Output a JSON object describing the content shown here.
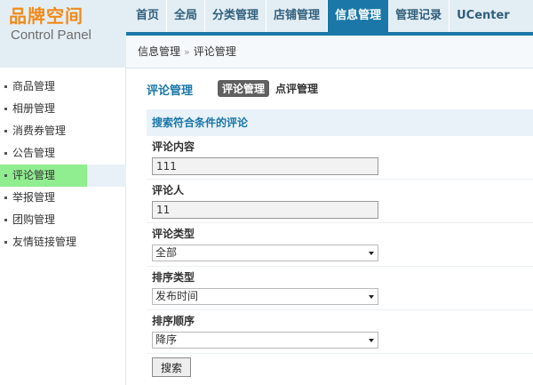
{
  "logo": {
    "title": "品牌空间",
    "subtitle": "Control Panel"
  },
  "nav": {
    "items": [
      "首页",
      "全局",
      "分类管理",
      "店铺管理",
      "信息管理",
      "管理记录",
      "UCenter"
    ],
    "active_index": 4
  },
  "breadcrumb": {
    "parent": "信息管理",
    "separator": "»",
    "current": "评论管理"
  },
  "sidebar": {
    "items": [
      {
        "label": "商品管理"
      },
      {
        "label": "相册管理"
      },
      {
        "label": "消费券管理"
      },
      {
        "label": "公告管理"
      },
      {
        "label": "评论管理",
        "active": true
      },
      {
        "label": "举报管理"
      },
      {
        "label": "团购管理"
      },
      {
        "label": "友情链接管理"
      }
    ]
  },
  "main": {
    "title": "评论管理",
    "tabs": [
      {
        "label": "评论管理",
        "active": true
      },
      {
        "label": "点评管理"
      }
    ]
  },
  "search": {
    "heading": "搜索符合条件的评论",
    "content_label": "评论内容",
    "content_value": "111",
    "author_label": "评论人",
    "author_value": "11",
    "type_label": "评论类型",
    "type_selected": "全部",
    "sort_label": "排序类型",
    "sort_selected": "发布时间",
    "order_label": "排序顺序",
    "order_selected": "降序",
    "submit_label": "搜索"
  },
  "colors": {
    "accent": "#1a77a8",
    "logo": "#f28a1a",
    "highlight": "#90ee90",
    "header_bg": "#e3eef4"
  }
}
